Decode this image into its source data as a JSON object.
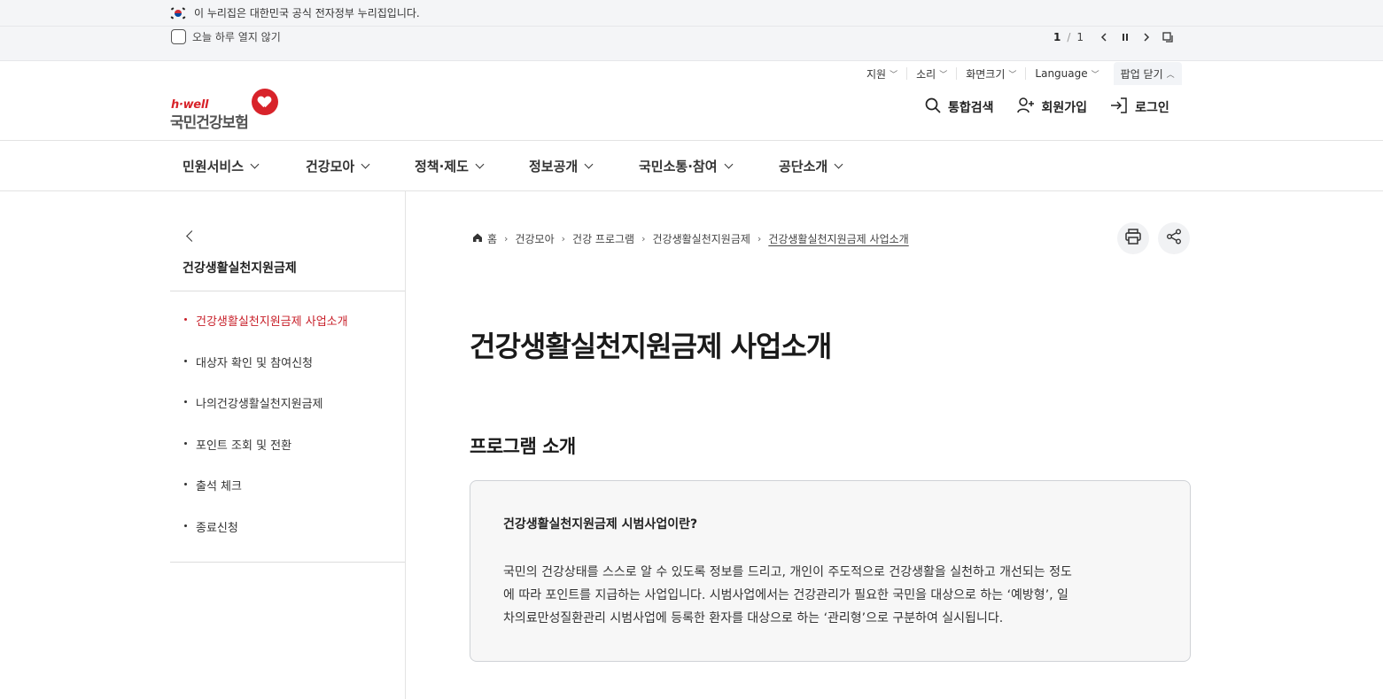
{
  "gov_banner": {
    "text": "이 누리집은 대한민국 공식 전자정부 누리집입니다."
  },
  "popup": {
    "dont_show_today": "오늘 하루 열지 않기",
    "page_current": "1",
    "page_sep": "/",
    "page_total": "1"
  },
  "utility": {
    "support": "지원",
    "sound": "소리",
    "screen_size": "화면크기",
    "language": "Language",
    "popup_close": "팝업 닫기"
  },
  "logo": {
    "tagline": "h·well",
    "name": "국민건강보험"
  },
  "header": {
    "search": "통합검색",
    "join": "회원가입",
    "login": "로그인"
  },
  "gnb": {
    "items": [
      "민원서비스",
      "건강모아",
      "정책·제도",
      "정보공개",
      "국민소통·참여",
      "공단소개"
    ]
  },
  "lnb": {
    "title": "건강생활실천지원금제",
    "items": [
      "건강생활실천지원금제 사업소개",
      "대상자 확인 및 참여신청",
      "나의건강생활실천지원금제",
      "포인트 조회 및 전환",
      "출석 체크",
      "종료신청"
    ]
  },
  "breadcrumb": {
    "home": "홈",
    "items": [
      "건강모아",
      "건강 프로그램",
      "건강생활실천지원금제",
      "건강생활실천지원금제 사업소개"
    ]
  },
  "content": {
    "title": "건강생활실천지원금제 사업소개",
    "section_title": "프로그램 소개",
    "box_title": "건강생활실천지원금제 시범사업이란?",
    "box_line1": "국민의 건강상태를 스스로 알 수 있도록 정보를 드리고, 개인이 주도적으로 건강생활을 실천하고 개선되는 정도",
    "box_line2": "에 따라 포인트를 지급하는 사업입니다. 시범사업에서는 건강관리가 필요한 국민을 대상으로 하는 ‘예방형’, 일",
    "box_line3": "차의료만성질환관리 시범사업에 등록한 환자를 대상으로 하는 ‘관리형’으로 구분하여 실시됩니다."
  },
  "colors": {
    "brand_red": "#d8232a",
    "active_red": "#c8202a"
  }
}
